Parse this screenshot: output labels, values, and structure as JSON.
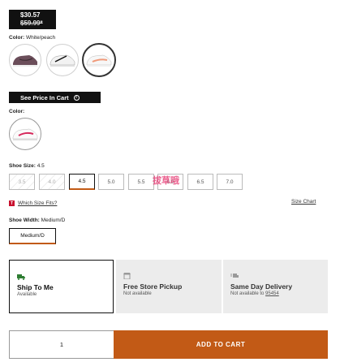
{
  "price": {
    "current": "$30.57",
    "original": "$59.99*"
  },
  "color1": {
    "label": "Color:",
    "value": "White/peach"
  },
  "swatches": [
    {
      "name": "Plum/black",
      "selected": false
    },
    {
      "name": "White/black",
      "selected": false
    },
    {
      "name": "White/peach",
      "selected": true
    }
  ],
  "cart_banner": {
    "label": "See Price In Cart",
    "icon": "info-icon"
  },
  "color2": {
    "label": "Color:",
    "value": ""
  },
  "size": {
    "label": "Shoe Size:",
    "value": "4.5",
    "options": [
      {
        "label": "3.5",
        "available": false
      },
      {
        "label": "4.0",
        "available": false
      },
      {
        "label": "4.5",
        "available": true,
        "selected": true
      },
      {
        "label": "5.0",
        "available": true
      },
      {
        "label": "5.5",
        "available": true
      },
      {
        "label": "6.0",
        "available": true
      },
      {
        "label": "6.5",
        "available": true
      },
      {
        "label": "7.0",
        "available": true
      }
    ]
  },
  "fit": {
    "badge": "T",
    "link": "Which Size Fits?"
  },
  "size_chart": "Size Chart",
  "width": {
    "label": "Shoe Width:",
    "value": "Medium/D",
    "option": "Medium/D"
  },
  "shipping": [
    {
      "title": "Ship To Me",
      "status": "Available",
      "icon": "truck-icon",
      "selected": true
    },
    {
      "title": "Free Store Pickup",
      "status": "Not available",
      "icon": "store-icon",
      "selected": false
    },
    {
      "title": "Same Day Delivery",
      "status": "Not available to",
      "zip": "95454",
      "icon": "delivery-icon",
      "selected": false
    }
  ],
  "quantity": "1",
  "add_to_cart": "ADD TO CART",
  "watermark": "拔草哦",
  "colors": {
    "accent": "#c25a16",
    "dark": "#111111",
    "badge_red": "#c8102e"
  }
}
